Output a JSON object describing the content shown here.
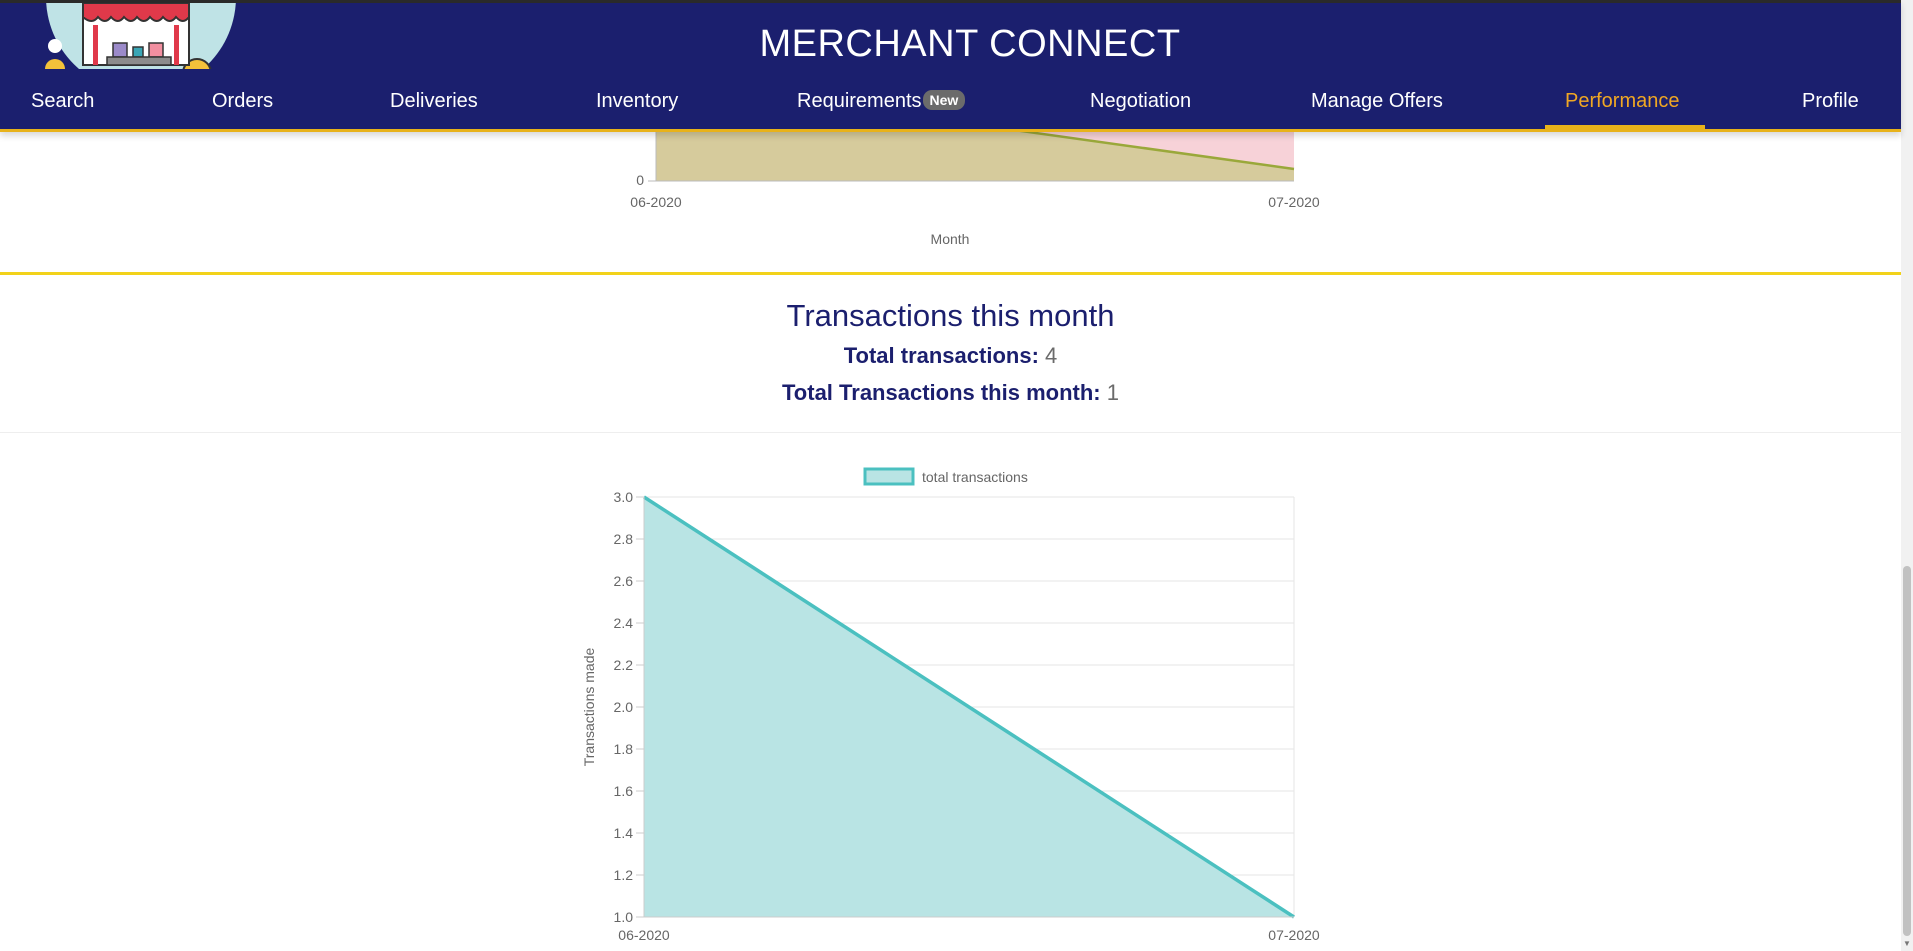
{
  "header": {
    "title": "MERCHANT CONNECT",
    "brand_color": "#1b1f6e",
    "accent_color": "#f0a723"
  },
  "nav": {
    "items": [
      {
        "label": "Search"
      },
      {
        "label": "Orders"
      },
      {
        "label": "Deliveries"
      },
      {
        "label": "Inventory"
      },
      {
        "label": "Requirements",
        "badge": "New"
      },
      {
        "label": "Negotiation"
      },
      {
        "label": "Manage Offers"
      },
      {
        "label": "Performance",
        "active": true
      },
      {
        "label": "Profile"
      }
    ]
  },
  "upper_chart": {
    "x_ticks": [
      "06-2020",
      "07-2020"
    ],
    "y_tick": "0",
    "xlabel": "Month"
  },
  "transactions": {
    "title": "Transactions this month",
    "total_label": "Total transactions:",
    "total_value": "4",
    "month_label": "Total Transactions this month:",
    "month_value": "1"
  },
  "chart_data": [
    {
      "type": "area",
      "categories": [
        "06-2020",
        "07-2020"
      ],
      "series": [
        {
          "name": "total transactions",
          "values": [
            3,
            1
          ],
          "color": "#4bc0c0",
          "fill": "#b9e4e4"
        }
      ],
      "xlabel": "",
      "ylabel": "Transactions made",
      "ylim": [
        1.0,
        3.0
      ],
      "yticks": [
        "1.0",
        "1.2",
        "1.4",
        "1.6",
        "1.8",
        "2.0",
        "2.2",
        "2.4",
        "2.6",
        "2.8",
        "3.0"
      ],
      "grid": true,
      "legend": "top"
    }
  ]
}
